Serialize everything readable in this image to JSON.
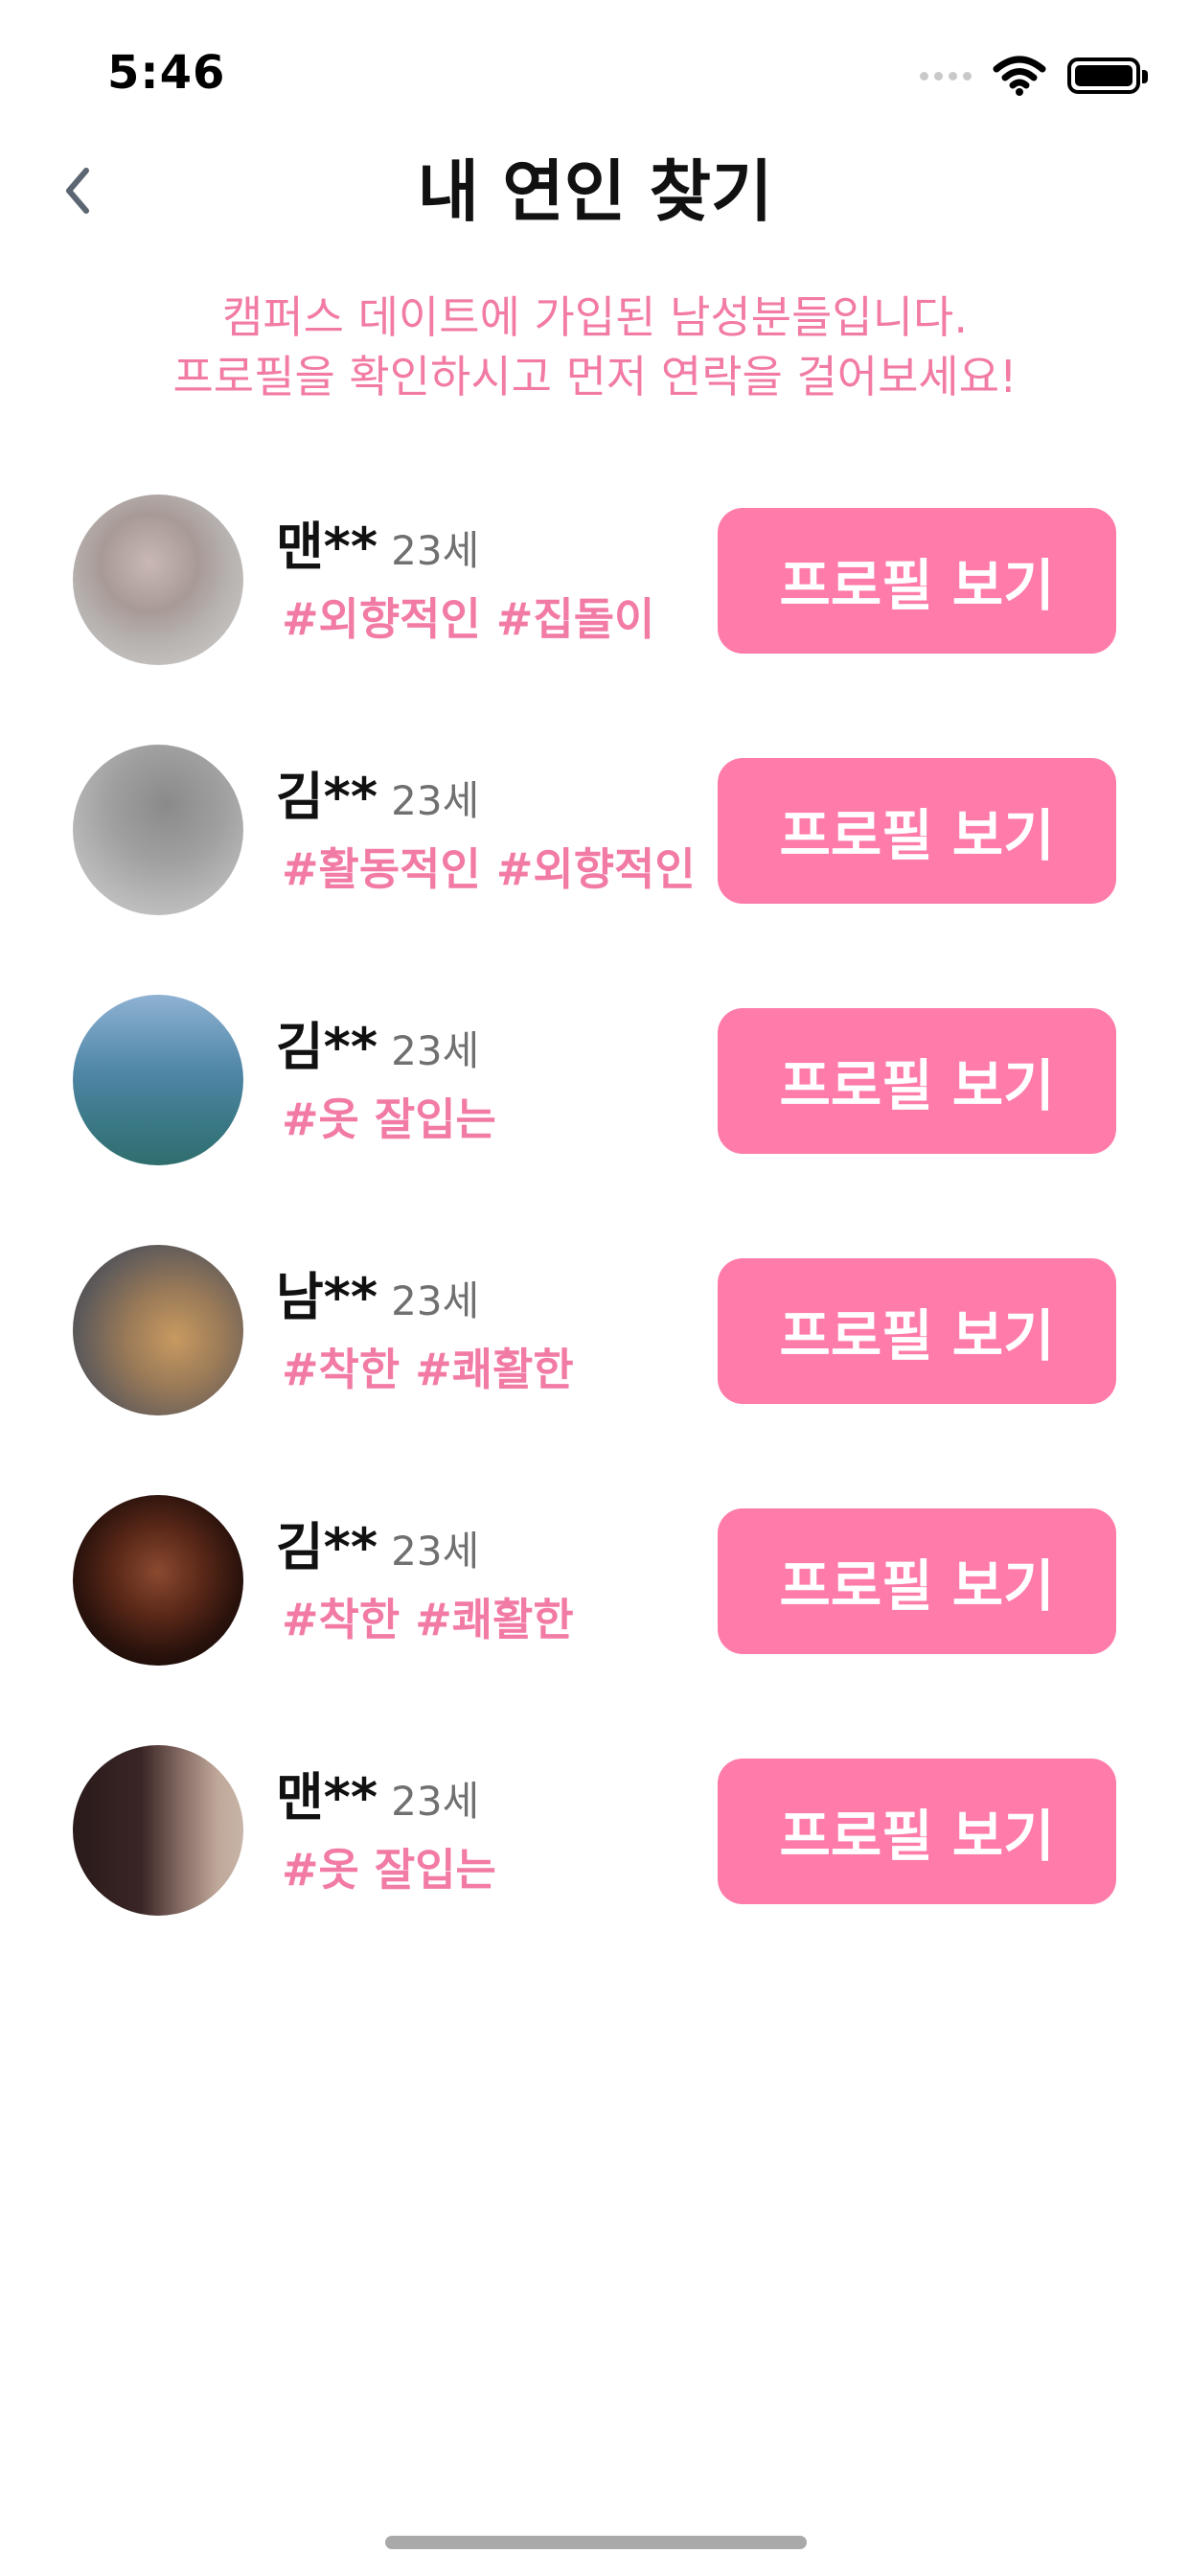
{
  "status_bar": {
    "time": "5:46",
    "icons": [
      "signal-dots-icon",
      "wifi-icon",
      "battery-icon"
    ]
  },
  "header": {
    "back_icon": "chevron-left-icon",
    "title": "내 연인 찾기"
  },
  "subtitle": {
    "line1": "캠퍼스 데이트에 가입된 남성분들입니다.",
    "line2": "프로필을 확인하시고 먼저 연락을 걸어보세요!"
  },
  "profiles": [
    {
      "name": "맨**",
      "age": "23세",
      "tags": "#외향적인 #집돌이",
      "button_label": "프로필 보기"
    },
    {
      "name": "김**",
      "age": "23세",
      "tags": "#활동적인 #외향적인",
      "button_label": "프로필 보기"
    },
    {
      "name": "김**",
      "age": "23세",
      "tags": "#옷 잘입는",
      "button_label": "프로필 보기"
    },
    {
      "name": "남**",
      "age": "23세",
      "tags": "#착한 #쾌활한",
      "button_label": "프로필 보기"
    },
    {
      "name": "김**",
      "age": "23세",
      "tags": "#착한 #쾌활한",
      "button_label": "프로필 보기"
    },
    {
      "name": "맨**",
      "age": "23세",
      "tags": "#옷 잘입는",
      "button_label": "프로필 보기"
    }
  ],
  "colors": {
    "accent": "#ff7baa",
    "accent_text": "#f27ba5",
    "title": "#111111",
    "age": "#707070"
  }
}
